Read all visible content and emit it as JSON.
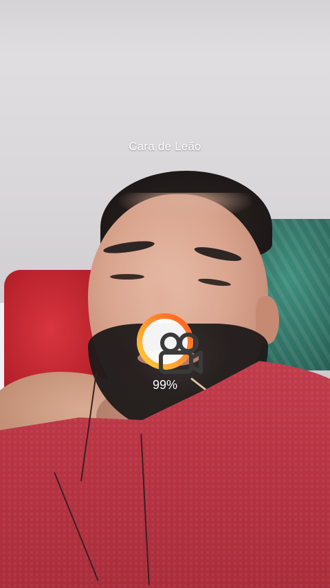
{
  "overlay": {
    "filter_name": "Cara de Leão",
    "progress_percent_text": "99%",
    "progress_fraction": 0.99,
    "progress_icon": "video-camera-icon",
    "colors": {
      "ring_start": "#ffcf3a",
      "ring_end": "#ff5a1f",
      "ring_track": "rgba(255,255,255,0.9)",
      "text": "#ffffff"
    }
  }
}
